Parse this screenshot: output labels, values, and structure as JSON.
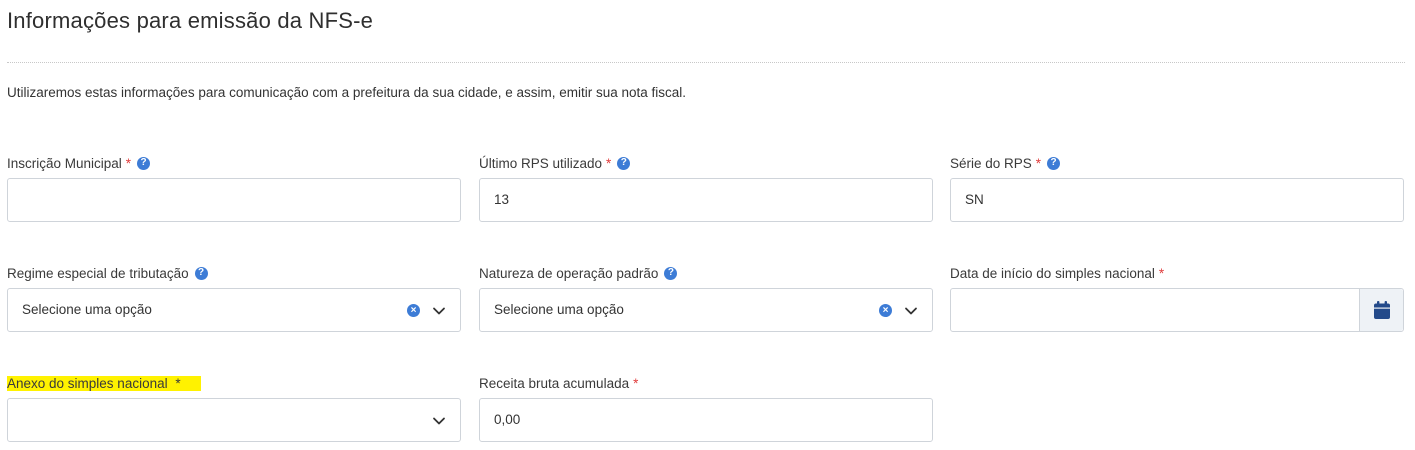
{
  "page": {
    "title": "Informações para emissão da NFS-e",
    "description": "Utilizaremos estas informações para comunicação com a prefeitura da sua cidade, e assim, emitir sua nota fiscal."
  },
  "fields": {
    "inscricao": {
      "label": "Inscrição Municipal",
      "required": "*",
      "value": ""
    },
    "ultimo_rps": {
      "label": "Último RPS utilizado",
      "required": "*",
      "value": "13"
    },
    "serie_rps": {
      "label": "Série do RPS",
      "required": "*",
      "value": "SN"
    },
    "regime": {
      "label": "Regime especial de tributação",
      "value": "Selecione uma opção"
    },
    "natureza": {
      "label": "Natureza de operação padrão",
      "value": "Selecione uma opção"
    },
    "data_inicio": {
      "label": "Data de início do simples nacional",
      "required": "*",
      "value": ""
    },
    "anexo": {
      "label": "Anexo do simples nacional",
      "required": "*",
      "value": ""
    },
    "receita": {
      "label": "Receita bruta acumulada",
      "required": "*",
      "value": "0,00"
    }
  },
  "icons": {
    "help": "?",
    "clear": "×"
  },
  "colors": {
    "accent": "#3d7cd6",
    "required": "#e03c3c",
    "highlight": "#fff200",
    "border": "#cfd4da"
  }
}
